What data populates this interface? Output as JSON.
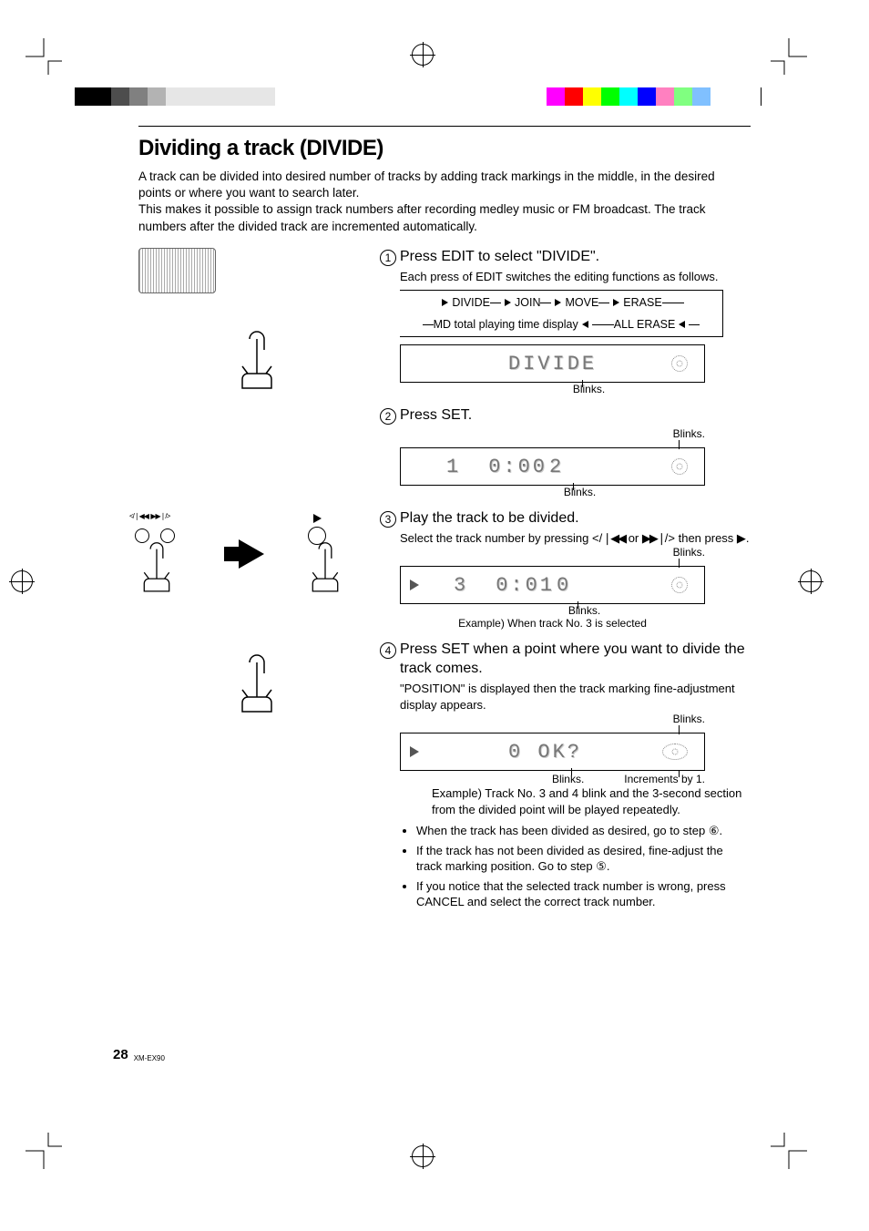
{
  "page": {
    "number": "28",
    "model": "XM-EX90"
  },
  "title": "Dividing a track (DIVIDE)",
  "intro": "A track can be divided into desired number of tracks by adding track markings in the middle, in the desired points or where you want to search later.\nThis makes it possible to assign track numbers after recording medley music or FM broadcast. The track numbers after the divided track are incremented automatically.",
  "flow": {
    "items": [
      "DIVIDE",
      "JOIN",
      "MOVE",
      "ERASE"
    ],
    "back_right": "ALL ERASE",
    "back_left": "MD total playing time display"
  },
  "steps": [
    {
      "num": "1",
      "title": "Press EDIT to select \"DIVIDE\".",
      "sub": "Each press of EDIT switches the editing functions as follows.",
      "lcd": {
        "main": "DIVIDE",
        "disc": true
      },
      "ann_below_center": "Blinks."
    },
    {
      "num": "2",
      "title": "Press SET.",
      "ann_top_right": "Blinks.",
      "lcd": {
        "fields": [
          "1",
          "0:00",
          "2"
        ],
        "disc": true
      },
      "ann_below_center": "Blinks."
    },
    {
      "num": "3",
      "title": "Play the track to be divided.",
      "sub_pre": "Select the track number by pressing </",
      "sub_mid": " or ",
      "sub_post": "/> then press ",
      "sub_end": ".",
      "ann_top_right": "Blinks.",
      "lcd": {
        "play": true,
        "fields": [
          "3",
          "0:01",
          "0"
        ],
        "disc": true
      },
      "ann_below_center": "Blinks.",
      "example": "Example) When track No. 3 is selected"
    },
    {
      "num": "4",
      "title": "Press SET when a point where you want to divide the track comes.",
      "sub": "\"POSITION\" is displayed then the track marking fine-adjustment display appears.",
      "ann_top_right": "Blinks.",
      "lcd": {
        "play": true,
        "fields": [
          "",
          "0  OK?",
          ""
        ],
        "disc": true,
        "disc_wide": true
      },
      "ann_below": {
        "left": "",
        "center": "Blinks.",
        "right": "Increments by 1."
      },
      "example": "Example) Track No. 3 and 4 blink and the 3-second section from the divided point will be played repeatedly.",
      "notes": [
        "When the track has been divided as desired, go to step ⑥.",
        "If the track has not been divided as desired, fine-adjust the track marking position. Go to step ⑤.",
        "If you notice that the selected track number is wrong, press CANCEL and select the correct track number."
      ]
    }
  ],
  "transport_label": "❘◀◀  ▶▶❘/>"
}
